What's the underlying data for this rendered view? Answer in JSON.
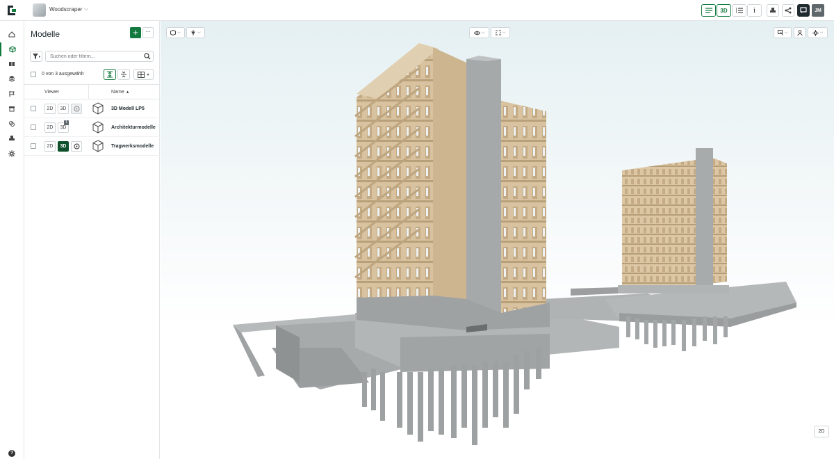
{
  "project": {
    "name": "Woodscraper"
  },
  "topbar": {
    "list_icon": "list-icon",
    "mode_3d": "3D",
    "split_icon": "split-view-icon",
    "info_icon": "info-icon",
    "user": "JM"
  },
  "rail": {
    "items": [
      "home-icon",
      "model-cube-icon",
      "book-icon",
      "layers-icon",
      "issues-icon",
      "archive-icon",
      "clash-icon",
      "stamp-icon",
      "settings-icon"
    ],
    "active": "model-cube-icon",
    "help": "?"
  },
  "panel": {
    "title": "Modelle",
    "add_label": "+",
    "more_label": "···",
    "search_placeholder": "Suchen oder filtern...",
    "selection_text": "0 von 3 ausgewählt",
    "columns": {
      "viewer": "Viewer",
      "name": "Name"
    },
    "rows": [
      {
        "name": "3D Modell LP5",
        "btn_2d": "2D",
        "btn_3d": "3D",
        "active3d": false
      },
      {
        "name": "Architekturmodelle",
        "btn_2d": "2D",
        "btn_3d": "3D",
        "active3d": false,
        "badge": "1"
      },
      {
        "name": "Tragwerksmodelle",
        "btn_2d": "2D",
        "btn_3d": "3D",
        "active3d": true
      }
    ]
  },
  "viewer": {
    "mode_2d": "2D"
  },
  "colors": {
    "accent": "#127a3f",
    "wood": "#d9c29f",
    "concrete": "#a9acad"
  }
}
